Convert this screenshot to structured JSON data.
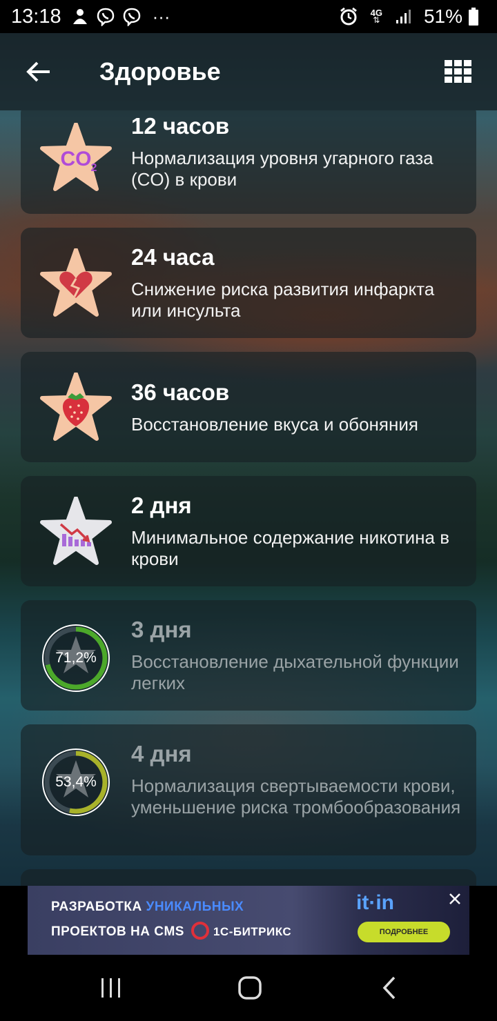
{
  "status_bar": {
    "time": "13:18",
    "network": "4G",
    "battery": "51%",
    "overflow": "···"
  },
  "app_bar": {
    "title": "Здоровье",
    "back_icon": "arrow-left-icon",
    "menu_icon": "grid-icon"
  },
  "milestones": [
    {
      "time": "12 часов",
      "description": "Нормализация уровня угарного газа (CO) в крови",
      "icon": "co2-star-icon",
      "achieved": true
    },
    {
      "time": "24 часа",
      "description": "Снижение риска развития инфаркта или инсульта",
      "icon": "broken-heart-star-icon",
      "achieved": true
    },
    {
      "time": "36 часов",
      "description": "Восстановление вкуса и обоняния",
      "icon": "strawberry-star-icon",
      "achieved": true
    },
    {
      "time": "2 дня",
      "description": "Минимальное содержание никотина в крови",
      "icon": "decline-chart-star-icon",
      "achieved": true
    },
    {
      "time": "3 дня",
      "description": "Восстановление дыхательной функции легких",
      "icon": "progress-ring-icon",
      "achieved": false,
      "progress_label": "71,2%",
      "progress": 0.712,
      "ring_color": "#4ca82a"
    },
    {
      "time": "4 дня",
      "description": "Нормализация свертываемости крови, уменьшение риска тромбообразования",
      "icon": "progress-ring-icon",
      "achieved": false,
      "progress_label": "53,4%",
      "progress": 0.534,
      "ring_color": "#a8b22a"
    }
  ],
  "ad": {
    "line1_a": "РАЗРАБОТКА ",
    "line1_b": "УНИКАЛЬНЫХ",
    "line2": "ПРОЕКТОВ НА CMS",
    "bitrix": "1С-БИТРИКС",
    "brand": "it·in",
    "more": "ПОДРОБНЕЕ"
  },
  "colors": {
    "star": "#f5c6a5",
    "star_gray": "#e6e6ea",
    "ring_track": "#3b4a52",
    "ad_accent": "#4a8bff",
    "ad_button": "#c7dc2b"
  }
}
